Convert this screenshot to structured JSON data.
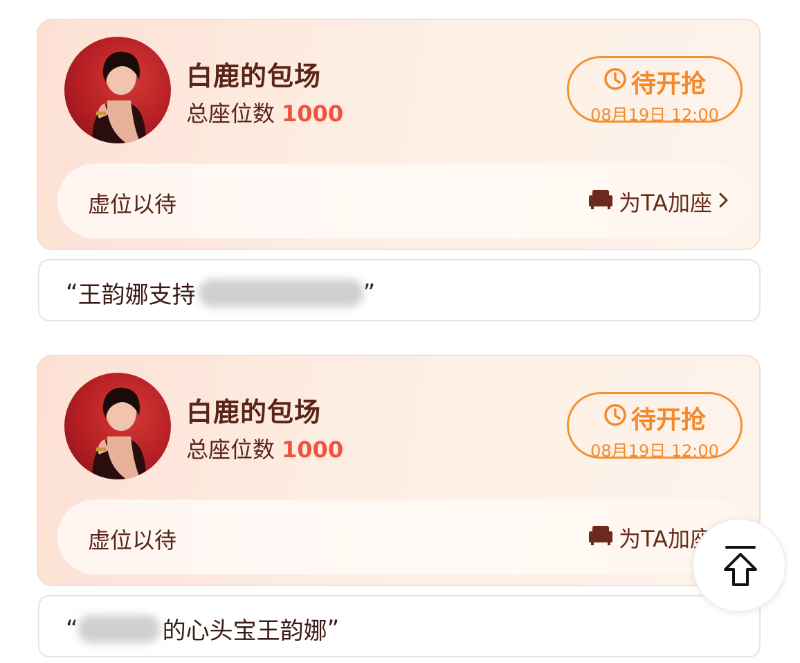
{
  "cards": [
    {
      "title": "白鹿的包场",
      "seats_label": "总座位数",
      "seats_value": "1000",
      "status_label": "待开抢",
      "status_time": "08月19日 12:00",
      "bar_left": "虚位以待",
      "bar_right": "为TA加座",
      "quote_open": "“",
      "quote_text": "王韵娜支持",
      "quote_close": "”"
    },
    {
      "title": "白鹿的包场",
      "seats_label": "总座位数",
      "seats_value": "1000",
      "status_label": "待开抢",
      "status_time": "08月19日 12:00",
      "bar_left": "虚位以待",
      "bar_right": "为TA加座",
      "quote_open": "“",
      "quote_text": "的心头宝王韵娜",
      "quote_close": "”"
    }
  ],
  "icons": {
    "status": "clock-icon",
    "add_seat": "sofa-icon",
    "chevron": "chevron-right-icon",
    "back_to_top": "back-to-top-icon"
  },
  "colors": {
    "accent_orange": "#f38a2a",
    "number_red": "#f0523a",
    "text_brown": "#5a2418"
  }
}
